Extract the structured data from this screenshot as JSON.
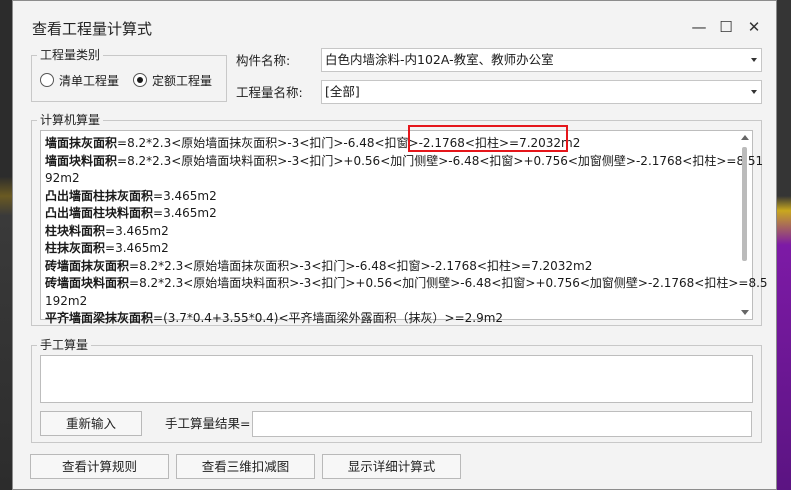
{
  "window": {
    "title": "查看工程量计算式",
    "minimize_glyph": "—",
    "maximize_glyph": "☐",
    "close_glyph": "✕"
  },
  "quantity_type": {
    "group_label": "工程量类别",
    "options": [
      {
        "label": "清单工程量",
        "checked": false
      },
      {
        "label": "定额工程量",
        "checked": true
      }
    ]
  },
  "component": {
    "label": "构件名称:",
    "value": "白色内墙涂料-内102A-教室、教师办公室"
  },
  "quantity_name": {
    "label": "工程量名称:",
    "value": "[全部]"
  },
  "computer_calc": {
    "group_label": "计算机算量",
    "lines": [
      {
        "bold": "墙面抹灰面积",
        "rest": "=8.2*2.3<原始墙面抹灰面积>-3<扣门>-6.48<扣窗>-2.1768<扣柱>=7.2032m2"
      },
      {
        "bold": "墙面块料面积",
        "rest": "=8.2*2.3<原始墙面块料面积>-3<扣门>+0.56<加门侧壁>-6.48<扣窗>+0.756<加窗侧壁>-2.1768<扣柱>=8.51"
      },
      {
        "bold": "",
        "rest": "92m2"
      },
      {
        "bold": "凸出墙面柱抹灰面积",
        "rest": "=3.465m2"
      },
      {
        "bold": "凸出墙面柱块料面积",
        "rest": "=3.465m2"
      },
      {
        "bold": "柱块料面积",
        "rest": "=3.465m2"
      },
      {
        "bold": "柱抹灰面积",
        "rest": "=3.465m2"
      },
      {
        "bold": "砖墙面抹灰面积",
        "rest": "=8.2*2.3<原始墙面抹灰面积>-3<扣门>-6.48<扣窗>-2.1768<扣柱>=7.2032m2"
      },
      {
        "bold": "砖墙面块料面积",
        "rest": "=8.2*2.3<原始墙面块料面积>-3<扣门>+0.56<加门侧壁>-6.48<扣窗>+0.756<加窗侧壁>-2.1768<扣柱>=8.5"
      },
      {
        "bold": "",
        "rest": "192m2"
      },
      {
        "bold": "平齐墙面梁抹灰面积",
        "rest": "=(3.7*0.4+3.55*0.4)<平齐墙面梁外露面积（抹灰）>=2.9m2"
      }
    ]
  },
  "manual_calc": {
    "group_label": "手工算量",
    "reinput_button": "重新输入",
    "result_label": "手工算量结果=",
    "result_value": ""
  },
  "bottom_buttons": {
    "view_rules": "查看计算规则",
    "view_3d": "查看三维扣减图",
    "show_detail": "显示详细计算式"
  },
  "colors": {
    "highlight_box": "#e5161b"
  }
}
